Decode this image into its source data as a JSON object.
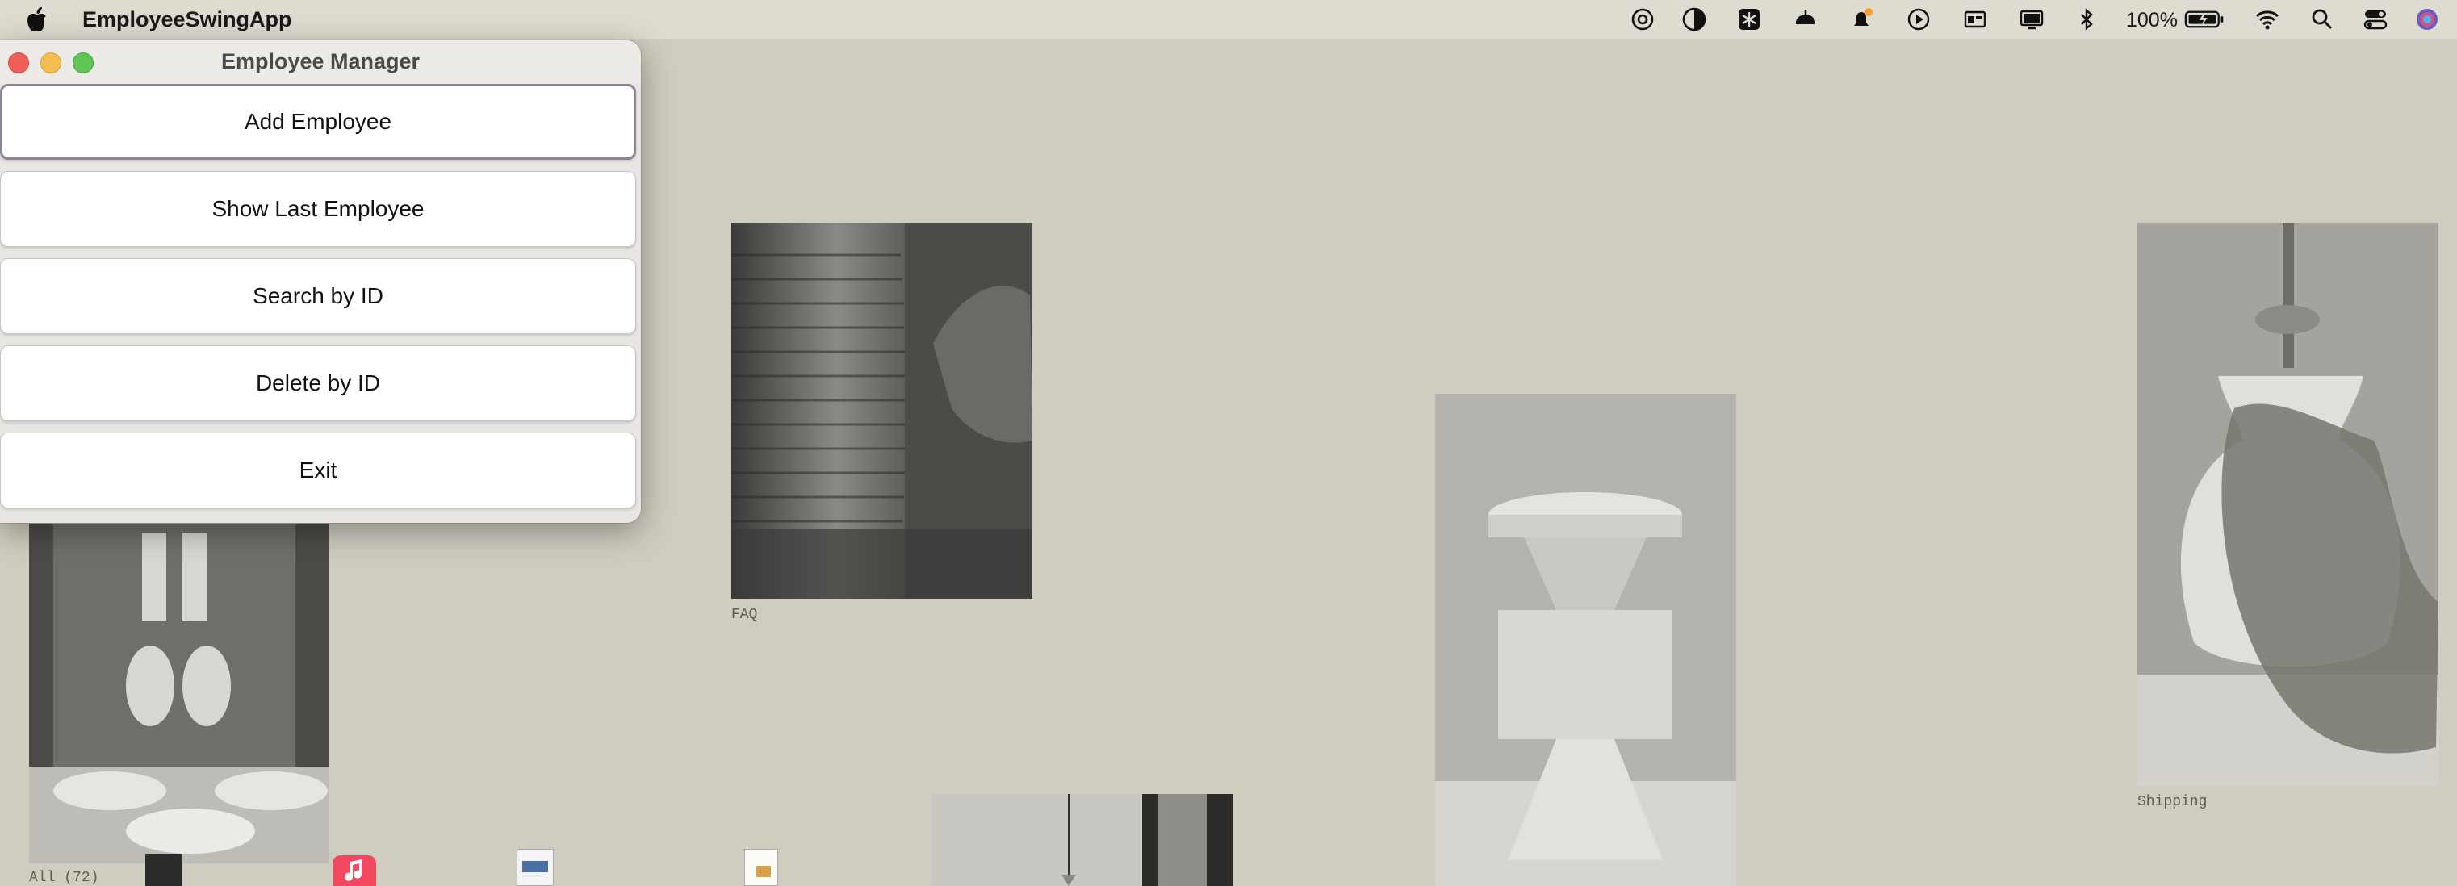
{
  "menubar": {
    "app_name": "EmployeeSwingApp",
    "battery_percent": "100%"
  },
  "window": {
    "title": "Employee Manager",
    "buttons": [
      {
        "label": "Add Employee"
      },
      {
        "label": "Show Last Employee"
      },
      {
        "label": "Search by ID"
      },
      {
        "label": "Delete by ID"
      },
      {
        "label": "Exit"
      }
    ]
  },
  "desktop": {
    "captions": {
      "faq": "FAQ",
      "shipping": "Shipping",
      "all": "All (72)"
    }
  },
  "colors": {
    "desktop_bg": "#cfccc0",
    "menubar_bg": "#dedbd0",
    "close": "#ee5e56",
    "minimize": "#f5bd4f",
    "zoom": "#5fc454"
  }
}
